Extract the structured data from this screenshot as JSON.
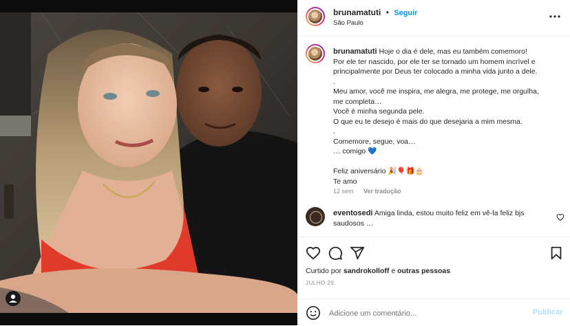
{
  "post": {
    "username": "brunamatuti",
    "follow_label": "Seguir",
    "separator": "•",
    "location": "São Paulo",
    "more_icon": "more-horizontal-icon"
  },
  "caption": {
    "username": "brunamatuti",
    "lines": [
      "Hoje o dia é dele, mas eu também comemoro!",
      "Por ele ter nascido, por ele ter se tornado um homem incrível e",
      "principalmente por Deus ter colocado a minha vida junto a dele.",
      ".",
      "Meu amor, você me inspira, me alegra, me protege, me orgulha,",
      "me completa…",
      "Você é minha segunda pele.",
      "O que eu te desejo é mais do que desejaria a mim mesma.",
      ".",
      "Comemore, segue, voa…",
      "… comigo 💙",
      "",
      "Feliz aniversário 🎉🎈🎁🎂",
      "Te amo"
    ],
    "age": "12 sem",
    "see_translation": "Ver tradução"
  },
  "comments": [
    {
      "username": "eventosedi",
      "text": "Amiga linda, estou muito feliz em vê-la feliz bjs saudosos …"
    }
  ],
  "actions": {
    "like_icon": "heart-icon",
    "comment_icon": "comment-icon",
    "share_icon": "send-icon",
    "save_icon": "bookmark-icon"
  },
  "likes": {
    "prefix": "Curtido por",
    "user": "sandrokolloff",
    "connector": "e",
    "others": "outras pessoas"
  },
  "date": "JULHO 29",
  "add_comment": {
    "placeholder": "Adicione um comentário...",
    "publish_label": "Publicar"
  },
  "colors": {
    "accent": "#0095f6",
    "text": "#262626",
    "muted": "#8e8e8e",
    "publish_disabled": "#b2dffc"
  }
}
